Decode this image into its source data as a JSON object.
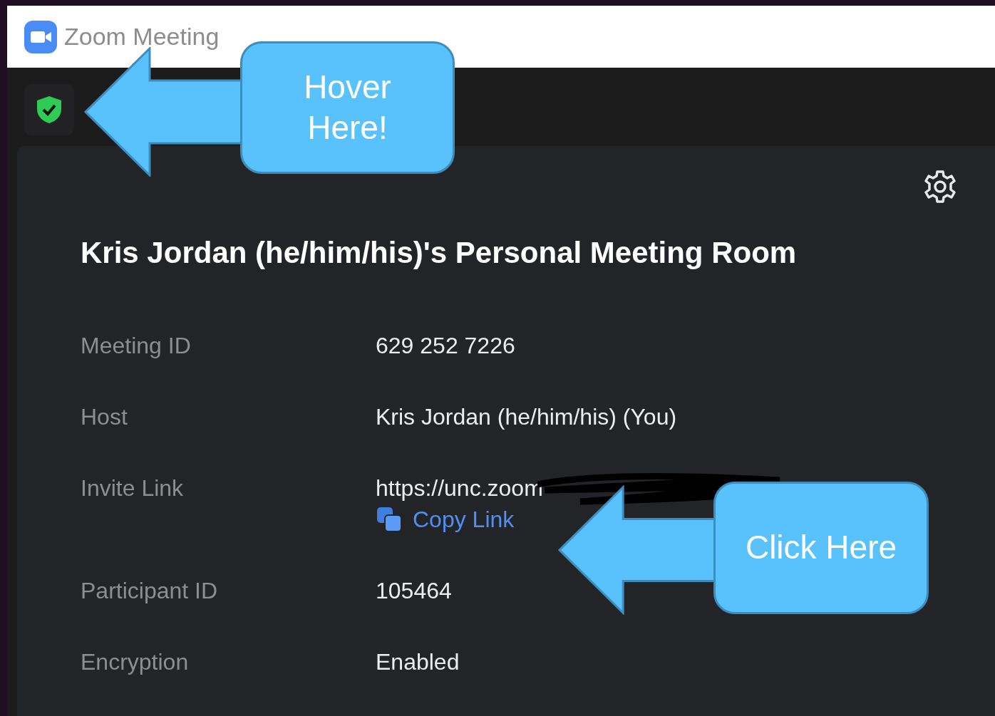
{
  "window": {
    "title": "Zoom Meeting"
  },
  "panel": {
    "title": "Kris Jordan (he/him/his)'s Personal Meeting Room",
    "rows": [
      {
        "kind": "text",
        "label": "Meeting ID",
        "value": "629 252 7226"
      },
      {
        "kind": "text",
        "label": "Host",
        "value": "Kris Jordan (he/him/his) (You)"
      },
      {
        "kind": "redacted-link",
        "label": "Invite Link",
        "value": "https://unc.zoom"
      },
      {
        "kind": "action",
        "value": "Copy Link"
      },
      {
        "kind": "text",
        "label": "Participant ID",
        "value": "105464"
      },
      {
        "kind": "text",
        "label": "Encryption",
        "value": "Enabled"
      }
    ]
  },
  "annotations": [
    {
      "kind": "hover",
      "text": "Hover Here!"
    },
    {
      "kind": "click",
      "text": "Click Here"
    }
  ]
}
